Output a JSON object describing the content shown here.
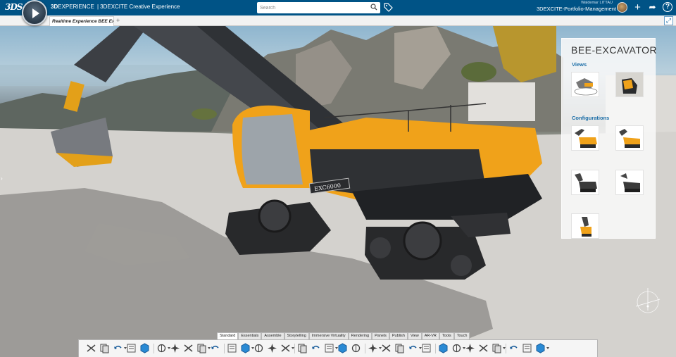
{
  "topbar": {
    "logo": "3DS",
    "brand_bold": "3D",
    "brand_rest": "EXPERIENCE",
    "separator": "|",
    "app_name": "3DEXCITE Creative Experience",
    "search_placeholder": "Search",
    "user_name": "Waldemar LITTAU",
    "collab_space": "3DEXCITE-Portfolio-Management",
    "collab_caret": "▾",
    "add_icon": "+",
    "share_icon": "➦",
    "help_icon": "?",
    "accent_color": "#005386"
  },
  "tabbar": {
    "active_tab": "Realtime Experience BEE Ex",
    "add_tab": "+",
    "expand_icon": "⤢"
  },
  "viewport": {
    "left_arrow": "›",
    "model_plate": "EXC6000"
  },
  "panel": {
    "title": "BEE-EXCAVATOR",
    "views_label": "Views",
    "configurations_label": "Configurations",
    "views": [
      "view-1",
      "view-2"
    ],
    "configurations": [
      "config-1",
      "config-2",
      "config-3",
      "config-4",
      "config-5"
    ]
  },
  "action_bar": {
    "tabs": [
      "Standard",
      "Essentials",
      "Assemble",
      "Storytelling",
      "Immersive Virtuality",
      "Rendering",
      "Panels",
      "Publish",
      "View",
      "AR-VR",
      "Tools",
      "Touch"
    ],
    "active_tab": "Standard",
    "tools": [
      "cut-icon",
      "copy-icon",
      "paste-icon",
      "undo-icon",
      "tree-icon",
      "sketch-icon",
      "annotate-icon",
      "zoom-icon",
      "cube-icon",
      "fit-all-icon",
      "pan-icon",
      "rotate-icon",
      "zoom-area-icon",
      "normal-view-icon",
      "magnifier-icon",
      "shading-icon",
      "hide-show-icon",
      "swap-icon",
      "render-icon",
      "ambience-icon",
      "image-icon",
      "capture-icon",
      "section-icon",
      "play-icon",
      "camera-icon",
      "explode-icon",
      "orbit-icon",
      "turntable-icon",
      "first-frame-icon",
      "last-frame-icon",
      "steering-icon",
      "export-icon",
      "properties-icon"
    ]
  }
}
